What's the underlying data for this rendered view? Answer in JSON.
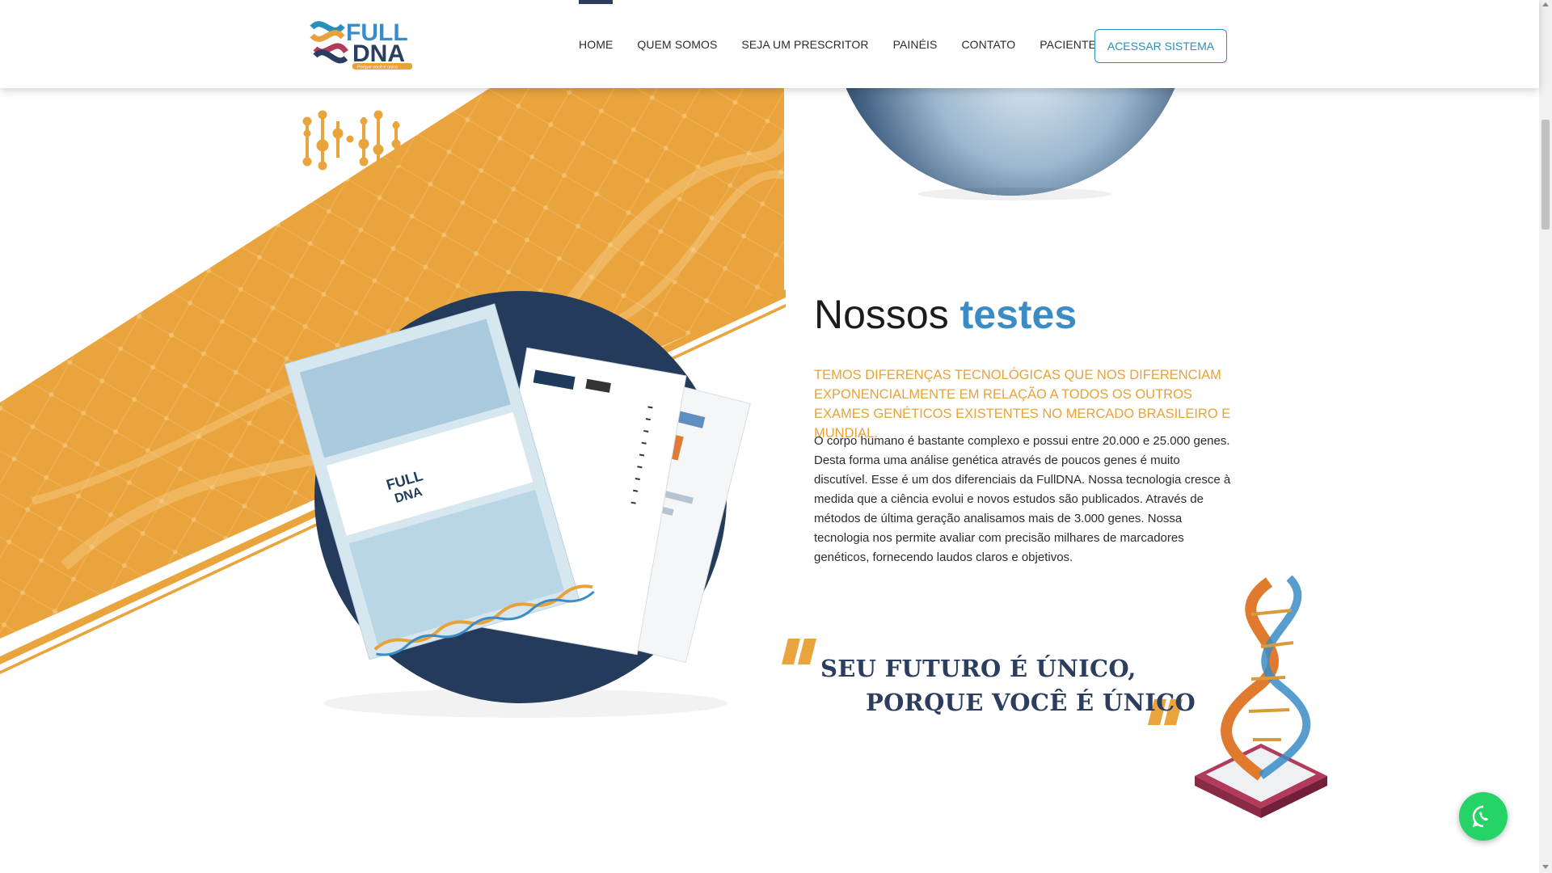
{
  "brand": {
    "logo_line1": "FULL",
    "logo_line2": "DNA",
    "tagline": "Porque você é único"
  },
  "nav": {
    "items": [
      {
        "label": "HOME",
        "active": true
      },
      {
        "label": "QUEM SOMOS"
      },
      {
        "label": "SEJA UM PRESCRITOR"
      },
      {
        "label": "PAINÉIS"
      },
      {
        "label": "CONTATO"
      },
      {
        "label": "PACIENTE"
      }
    ],
    "cta_label": "ACESSAR SISTEMA"
  },
  "section": {
    "title_part1": "Nossos",
    "title_part2": "testes",
    "lead": "TEMOS DIFERENÇAS TECNOLÓGICAS QUE NOS DIFERENCIAM EXPONENCIALMENTE EM RELAÇÃO A TODOS OS OUTROS EXAMES GENÉTICOS EXISTENTES NO MERCADO BRASILEIRO E MUNDIAL.",
    "body": "O corpo humano é bastante complexo e possui entre 20.000 e 25.000 genes. Desta forma uma análise genética através de poucos genes é muito discutível. Esse é um dos diferenciais da FullDNA. Nossa tecnologia cresce à medida que a ciência evolui e novos estudos são publicados. Através de métodos de última geração analisamos mais de 3.000 genes. Nossa tecnologia nos permite avaliar com precisão milhares de marcadores genéticos, fornecendo laudos claros e objetivos."
  },
  "quote": {
    "line1": "SEU FUTURO É ÚNICO,",
    "line2": "PORQUE VOCÊ É ÚNICO"
  },
  "colors": {
    "navy": "#2c3e5f",
    "blue": "#3a8cc6",
    "orange": "#e8a23a",
    "whatsapp": "#25d366"
  },
  "icons": [
    "dna-strand-icon",
    "dna-helix-illustration",
    "whatsapp-icon"
  ]
}
